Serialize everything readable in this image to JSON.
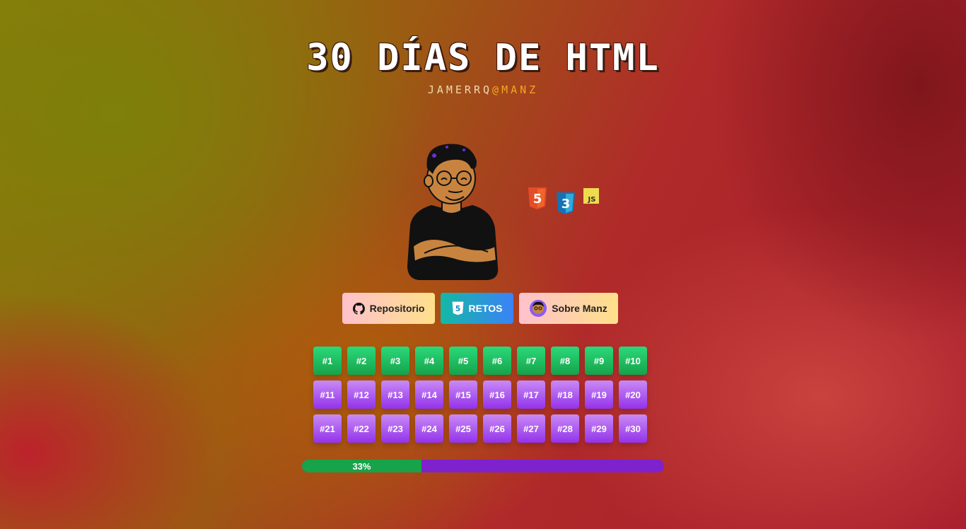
{
  "header": {
    "title": "30 DÍAS DE HTML",
    "subtitle_user": "JAMERRQ",
    "subtitle_at": "@",
    "subtitle_brand": "MANZ"
  },
  "tech_icons": [
    "html5-icon",
    "css3-icon",
    "javascript-icon"
  ],
  "tech_labels": {
    "html": "5",
    "css": "3",
    "js": "JS"
  },
  "buttons": {
    "repo": {
      "label": "Repositorio",
      "icon": "github-icon"
    },
    "retos": {
      "label": "RETOS",
      "icon": "html5-icon"
    },
    "manz": {
      "label": "Sobre Manz",
      "icon": "manz-avatar-icon"
    }
  },
  "days": [
    {
      "label": "#1",
      "done": true
    },
    {
      "label": "#2",
      "done": true
    },
    {
      "label": "#3",
      "done": true
    },
    {
      "label": "#4",
      "done": true
    },
    {
      "label": "#5",
      "done": true
    },
    {
      "label": "#6",
      "done": true
    },
    {
      "label": "#7",
      "done": true
    },
    {
      "label": "#8",
      "done": true
    },
    {
      "label": "#9",
      "done": true
    },
    {
      "label": "#10",
      "done": true
    },
    {
      "label": "#11",
      "done": false
    },
    {
      "label": "#12",
      "done": false
    },
    {
      "label": "#13",
      "done": false
    },
    {
      "label": "#14",
      "done": false
    },
    {
      "label": "#15",
      "done": false
    },
    {
      "label": "#16",
      "done": false
    },
    {
      "label": "#17",
      "done": false
    },
    {
      "label": "#18",
      "done": false
    },
    {
      "label": "#19",
      "done": false
    },
    {
      "label": "#20",
      "done": false
    },
    {
      "label": "#21",
      "done": false
    },
    {
      "label": "#22",
      "done": false
    },
    {
      "label": "#23",
      "done": false
    },
    {
      "label": "#24",
      "done": false
    },
    {
      "label": "#25",
      "done": false
    },
    {
      "label": "#26",
      "done": false
    },
    {
      "label": "#27",
      "done": false
    },
    {
      "label": "#28",
      "done": false
    },
    {
      "label": "#29",
      "done": false
    },
    {
      "label": "#30",
      "done": false
    }
  ],
  "progress": {
    "percent": 33,
    "label": "33%"
  },
  "colors": {
    "done": "#16a34a",
    "todo": "#9333ea",
    "progress_track": "#7e22ce"
  }
}
